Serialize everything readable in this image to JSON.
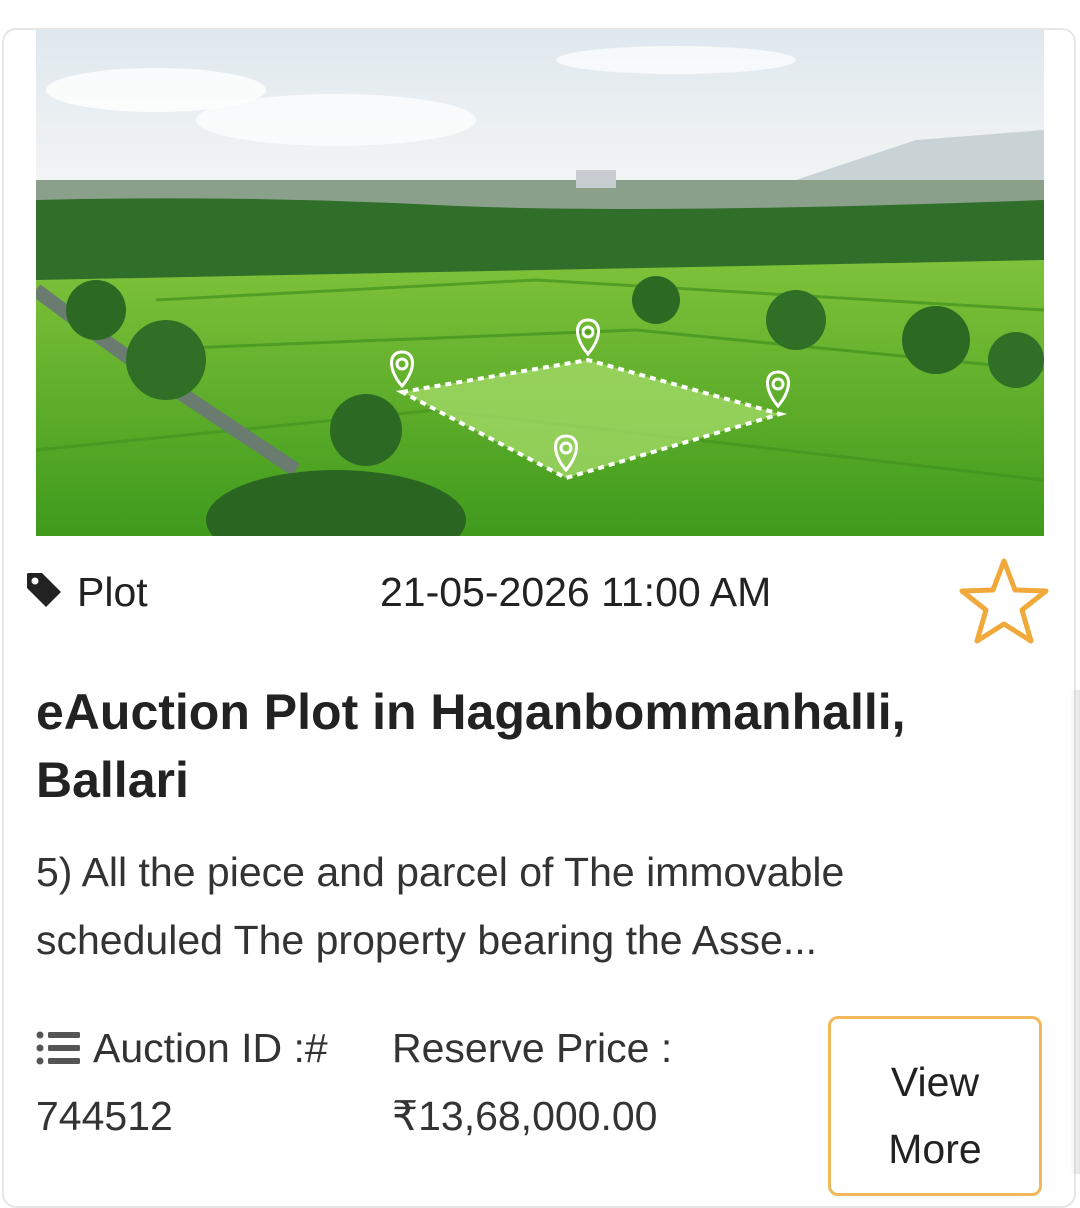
{
  "listing": {
    "category": "Plot",
    "datetime": "21-05-2026 11:00 AM",
    "title": "eAuction Plot in Haganbommanhalli, Ballari",
    "description": "5) All the piece and parcel of The immovable scheduled The property bearing the Asse...",
    "auction_id_label": "Auction ID :#",
    "auction_id_value": "744512",
    "reserve_price_label": "Reserve Price :",
    "reserve_price_value": "₹13,68,000.00",
    "view_more_label": "View More",
    "image_alt": "Aerial view of green plot with marked boundary"
  },
  "icons": {
    "category": "tag-icon",
    "favorite": "star-outline-icon",
    "auction_id": "list-icon"
  },
  "colors": {
    "accent": "#f0b85a",
    "star": "#f0a93a",
    "text": "#222222"
  }
}
